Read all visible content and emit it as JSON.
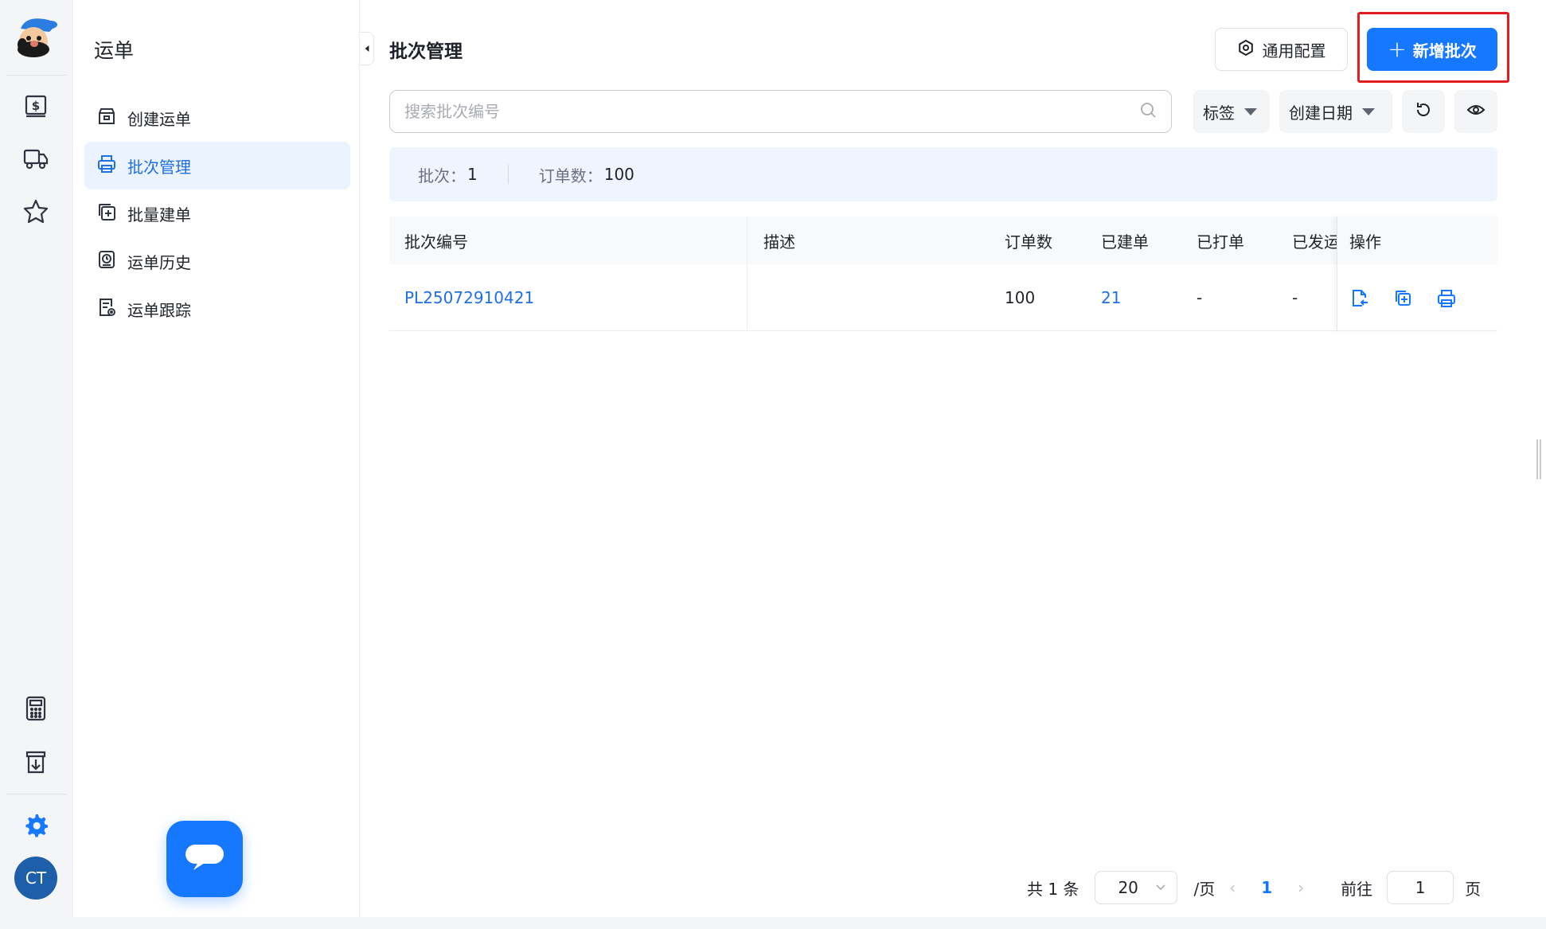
{
  "colors": {
    "accent": "#1677ff",
    "highlight": "#e31d1d",
    "summary_bg": "#eef5fe"
  },
  "rail": {
    "items": [
      {
        "icon": "invoice-dollar-icon"
      },
      {
        "icon": "truck-icon"
      },
      {
        "icon": "star-icon"
      }
    ],
    "bottom_items": [
      {
        "icon": "calculator-icon"
      },
      {
        "icon": "download-doc-icon"
      },
      {
        "icon": "gear-icon"
      }
    ],
    "avatar": "CT"
  },
  "sidebar": {
    "title": "运单",
    "items": [
      {
        "label": "创建运单",
        "icon": "box-icon",
        "active": false
      },
      {
        "label": "批次管理",
        "icon": "printer-icon",
        "active": true
      },
      {
        "label": "批量建单",
        "icon": "copy-plus-icon",
        "active": false
      },
      {
        "label": "运单历史",
        "icon": "history-icon",
        "active": false
      },
      {
        "label": "运单跟踪",
        "icon": "track-doc-icon",
        "active": false
      }
    ]
  },
  "header": {
    "title": "批次管理",
    "config_label": "通用配置",
    "add_label": "新增批次"
  },
  "toolbar": {
    "search_placeholder": "搜索批次编号",
    "search_value": "",
    "tag_filter": "标签",
    "date_filter": "创建日期"
  },
  "summary": {
    "batch_label": "批次：",
    "batch_value": "1",
    "order_label": "订单数：",
    "order_value": "100"
  },
  "table": {
    "columns": {
      "batch_no": "批次编号",
      "desc": "描述",
      "orders": "订单数",
      "built": "已建单",
      "printed": "已打单",
      "shipped": "已发运",
      "ops": "操作"
    },
    "rows": [
      {
        "batch_no": "PL25072910421",
        "desc": "",
        "orders": "100",
        "built": "21",
        "printed": "-",
        "shipped": "-"
      }
    ]
  },
  "pagination": {
    "total": "共 1 条",
    "page_size": "20",
    "per_page": "/页",
    "prev": "‹",
    "current": "1",
    "next": "›",
    "goto_label": "前往",
    "goto_value": "1",
    "page_suffix": "页"
  }
}
